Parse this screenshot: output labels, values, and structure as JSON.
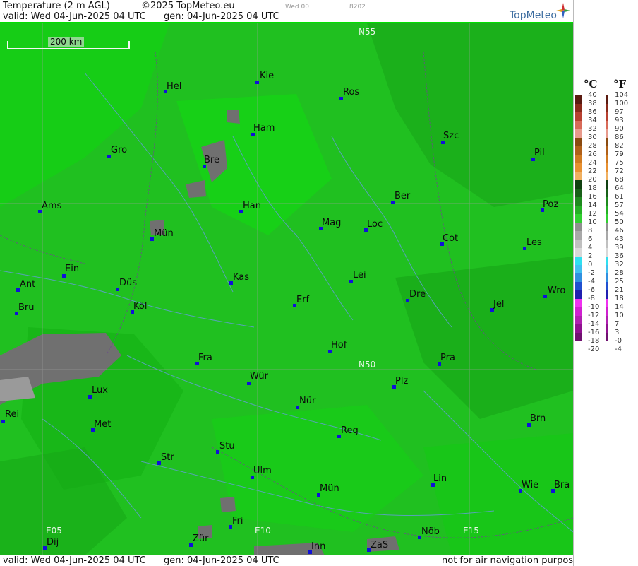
{
  "header": {
    "title": "Temperature (2 m AGL)",
    "copyright": "©2025 TopMeteo.eu",
    "small1": "Wed 00",
    "small2": "8202",
    "valid": "valid:  Wed  04-Jun-2025  04 UTC",
    "gen": "gen: 04-Jun-2025 04 UTC",
    "logo": "TopMeteo"
  },
  "footer": {
    "valid": "valid:  Wed  04-Jun-2025  04 UTC",
    "gen": "gen: 04-Jun-2025 04 UTC",
    "note": "not for air navigation purposes"
  },
  "scale_label": "200 km",
  "grid_labels": [
    "N55",
    "N50",
    "E05",
    "E10",
    "E15"
  ],
  "cities": [
    "Hel",
    "Kie",
    "Ros",
    "Ham",
    "Szc",
    "Gro",
    "Bre",
    "Pil",
    "Ams",
    "Han",
    "Ber",
    "Poz",
    "Mün",
    "Mag",
    "Loc",
    "Cot",
    "Les",
    "Ein",
    "Ant",
    "Düs",
    "Kas",
    "Lei",
    "Wro",
    "Bru",
    "Köl",
    "Erf",
    "Dre",
    "Jel",
    "Hof",
    "Fra",
    "Pra",
    "Lux",
    "Wür",
    "Plz",
    "Rei",
    "Nür",
    "Met",
    "Reg",
    "Brn",
    "Stu",
    "Str",
    "Ulm",
    "Lin",
    "Wie",
    "Bra",
    "Mün",
    "Fri",
    "Zür",
    "Nöb",
    "Dij",
    "Inn",
    "ZaS"
  ],
  "legend": {
    "unit_c": "°C",
    "unit_f": "°F",
    "celsius": [
      "40",
      "38",
      "36",
      "34",
      "32",
      "30",
      "28",
      "26",
      "24",
      "22",
      "20",
      "18",
      "16",
      "14",
      "12",
      "10",
      "8",
      "6",
      "4",
      "2",
      "0",
      "-2",
      "-4",
      "-6",
      "-8",
      "-10",
      "-12",
      "-14",
      "-16",
      "-18",
      "-20"
    ],
    "fahrenheit": [
      "104",
      "100",
      "97",
      "93",
      "90",
      "86",
      "82",
      "79",
      "75",
      "72",
      "68",
      "64",
      "61",
      "57",
      "54",
      "50",
      "46",
      "43",
      "39",
      "36",
      "32",
      "28",
      "25",
      "21",
      "18",
      "14",
      "10",
      "7",
      "3",
      "-0",
      "-4"
    ],
    "colors": [
      "#5a1a10",
      "#8a2a1a",
      "#b84030",
      "#d86a58",
      "#e89a8c",
      "#8a4a10",
      "#b06018",
      "#d07a20",
      "#e89030",
      "#f0b060",
      "#104010",
      "#186018",
      "#1e8a1e",
      "#24b024",
      "#30d030",
      "#909090",
      "#a8a8a8",
      "#c0c0c0",
      "#d8d8d8",
      "#30e0f0",
      "#40c0f0",
      "#3090e0",
      "#2050d0",
      "#2020b0",
      "#f030f0",
      "#d020d0",
      "#b020b0",
      "#901090",
      "#701070"
    ]
  }
}
